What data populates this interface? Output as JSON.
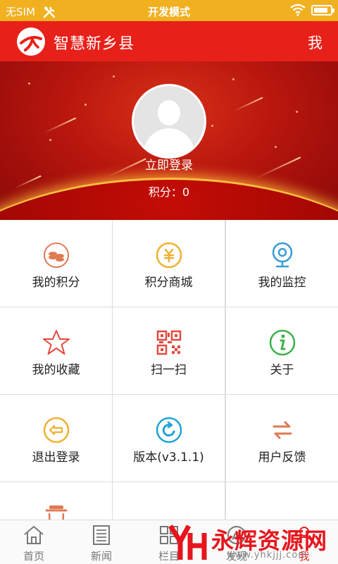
{
  "status_bar": {
    "carrier": "无SIM",
    "mode": "开发模式",
    "battery_level": 0.85,
    "color": "#f0b020"
  },
  "header": {
    "title": "智慧新乡县",
    "right_label": "我",
    "color": "#e8201a"
  },
  "profile": {
    "login_label": "立即登录",
    "points_text": "积分：0"
  },
  "grid": {
    "items": [
      {
        "label": "我的积分",
        "icon": "coins-icon",
        "color": "#e07a52"
      },
      {
        "label": "积分商城",
        "icon": "currency-icon",
        "color": "#f0b030"
      },
      {
        "label": "我的监控",
        "icon": "webcam-icon",
        "color": "#3a9bd8"
      },
      {
        "label": "我的收藏",
        "icon": "star-icon",
        "color": "#e24a3e"
      },
      {
        "label": "扫一扫",
        "icon": "qr-code-icon",
        "color": "#e24a3e"
      },
      {
        "label": "关于",
        "icon": "info-icon",
        "color": "#3cb04a"
      },
      {
        "label": "退出登录",
        "icon": "exit-icon",
        "color": "#f0b030"
      },
      {
        "label": "版本(v3.1.1)",
        "icon": "refresh-icon",
        "color": "#1fa3d6"
      },
      {
        "label": "用户反馈",
        "icon": "swap-arrows-icon",
        "color": "#e07a52"
      },
      {
        "label": "",
        "icon": "trash-icon",
        "color": "#e07a52"
      }
    ]
  },
  "bottom_nav": {
    "items": [
      {
        "label": "首页",
        "icon": "home-icon"
      },
      {
        "label": "新闻",
        "icon": "news-icon"
      },
      {
        "label": "栏目",
        "icon": "column-icon"
      },
      {
        "label": "发现",
        "icon": "discover-icon"
      },
      {
        "label": "我",
        "icon": "user-icon"
      }
    ],
    "active_color": "#e8201a"
  },
  "watermark": {
    "text": "永辉资源网",
    "url": "www.yhkjjj.com"
  }
}
